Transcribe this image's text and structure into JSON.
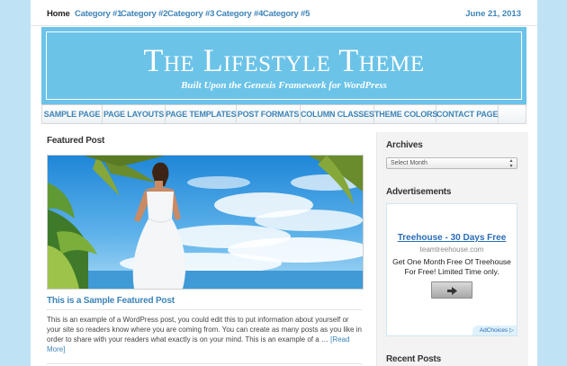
{
  "topnav": {
    "items": [
      "Home",
      "Category #1",
      "Category #2",
      "Category #3",
      "Category #4",
      "Category #5"
    ],
    "date": "June 21, 2013"
  },
  "header": {
    "title": "The Lifestyle Theme",
    "description": "Built Upon the Genesis Framework for WordPress"
  },
  "mainnav": {
    "items": [
      "SAMPLE PAGE",
      "PAGE LAYOUTS",
      "PAGE TEMPLATES",
      "POST FORMATS",
      "COLUMN CLASSES",
      "THEME COLORS",
      "CONTACT PAGE"
    ]
  },
  "featured": {
    "heading": "Featured Post",
    "post_title": "This is a Sample Featured Post",
    "excerpt": "This is an example of a WordPress post, you could edit this to put information about yourself or your site so readers know where you are coming from. You can create as many posts as you like in order to share with your readers what exactly is on your mind. This is an example of a … ",
    "read_more": "[Read More]"
  },
  "sidebar": {
    "archives_title": "Archives",
    "archives_select": "Select Month",
    "ads_title": "Advertisements",
    "ad": {
      "headline": "Treehouse - 30 Days Free",
      "domain": "teamtreehouse.com",
      "body": "Get One Month Free Of Treehouse For Free! Limited Time only.",
      "adchoices": "AdChoices"
    },
    "recent_title": "Recent Posts"
  },
  "colors": {
    "accent": "#3d84b8",
    "header_bg": "#6bc3e8",
    "page_bg": "#bfe3f5"
  }
}
